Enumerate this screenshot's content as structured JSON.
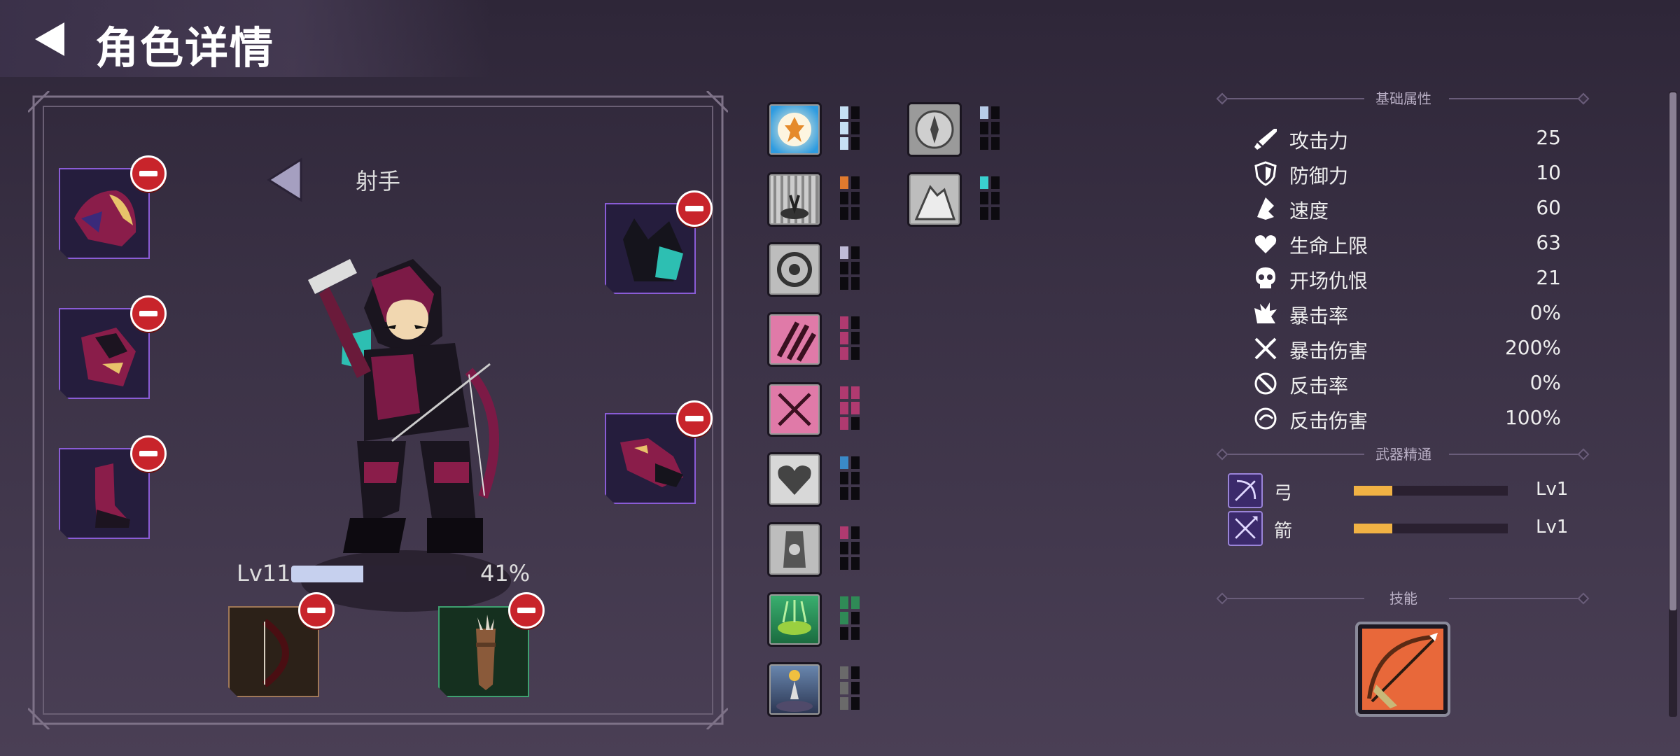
{
  "header": {
    "title": "角色详情"
  },
  "character": {
    "class_name": "射手",
    "level_label": "Lv11",
    "xp_percent_label": "41%",
    "xp_fraction": 0.41
  },
  "equipment": {
    "slots": [
      {
        "name": "helmet-slot",
        "rarity": "epic"
      },
      {
        "name": "armor-slot",
        "rarity": "epic"
      },
      {
        "name": "boots-slot",
        "rarity": "epic"
      },
      {
        "name": "hood-slot",
        "rarity": "epic"
      },
      {
        "name": "gloves-slot",
        "rarity": "epic"
      },
      {
        "name": "bow-slot",
        "rarity": "common"
      },
      {
        "name": "quiver-slot",
        "rarity": "uncommon"
      }
    ]
  },
  "sections": {
    "base_attributes": "基础属性",
    "weapon_mastery": "武器精通",
    "skills": "技能"
  },
  "stats": [
    {
      "icon": "sword-icon",
      "label": "攻击力",
      "value": "25"
    },
    {
      "icon": "shield-icon",
      "label": "防御力",
      "value": "10"
    },
    {
      "icon": "boot-icon",
      "label": "速度",
      "value": "60"
    },
    {
      "icon": "heart-icon",
      "label": "生命上限",
      "value": "63"
    },
    {
      "icon": "skull-icon",
      "label": "开场仇恨",
      "value": "21"
    },
    {
      "icon": "crit-burst-icon",
      "label": "暴击率",
      "value": "0%"
    },
    {
      "icon": "crossed-swords-icon",
      "label": "暴击伤害",
      "value": "200%"
    },
    {
      "icon": "counter-icon",
      "label": "反击率",
      "value": "0%"
    },
    {
      "icon": "counter-damage-icon",
      "label": "反击伤害",
      "value": "100%"
    }
  ],
  "weapons": [
    {
      "icon": "bow-mastery-icon",
      "label": "弓",
      "level": "Lv1",
      "progress": 0.25
    },
    {
      "icon": "arrow-mastery-icon",
      "label": "箭",
      "level": "Lv1",
      "progress": 0.25
    }
  ],
  "skill": {
    "icon": "bow-skill-icon"
  },
  "colors": {
    "slot_border_epic": "#8a5cd6",
    "remove_badge": "#c8242b",
    "xp_fill": "#c6d0ee",
    "mastery_fill": "#f1b244"
  }
}
